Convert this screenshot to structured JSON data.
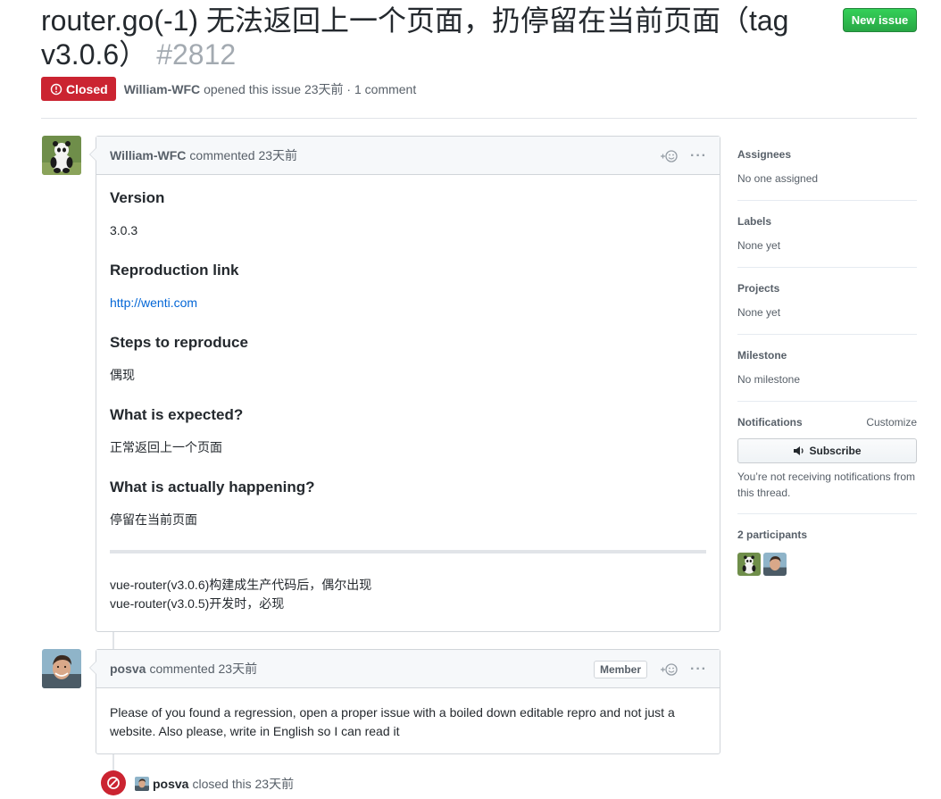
{
  "issue": {
    "title": "router.go(-1) 无法返回上一个页面，扔停留在当前页面（tag v3.0.6）",
    "number": "#2812",
    "state": "Closed",
    "author": "William-WFC",
    "meta": "opened this issue 23天前 · 1 comment"
  },
  "header": {
    "new_issue_label": "New issue"
  },
  "comments": [
    {
      "author": "William-WFC",
      "action": "commented 23天前",
      "reaction_label": "+☺",
      "more_label": "···",
      "body": {
        "h_version": "Version",
        "version": "3.0.3",
        "h_repro": "Reproduction link",
        "repro_link": "http://wenti.com",
        "h_steps": "Steps to reproduce",
        "steps": "偶现",
        "h_expected": "What is expected?",
        "expected": "正常返回上一个页面",
        "h_actual": "What is actually happening?",
        "actual": "停留在当前页面",
        "note_line1": "vue-router(v3.0.6)构建成生产代码后，偶尔出现",
        "note_line2": "vue-router(v3.0.5)开发时，必现"
      }
    },
    {
      "author": "posva",
      "action": "commented 23天前",
      "role": "Member",
      "reaction_label": "+☺",
      "more_label": "···",
      "body": "Please of you found a regression, open a proper issue with a boiled down editable repro and not just a website. Also please, write in English so I can read it"
    }
  ],
  "event": {
    "author": "posva",
    "text": "closed this 23天前"
  },
  "sidebar": {
    "assignees": {
      "heading": "Assignees",
      "value": "No one assigned"
    },
    "labels": {
      "heading": "Labels",
      "value": "None yet"
    },
    "projects": {
      "heading": "Projects",
      "value": "None yet"
    },
    "milestone": {
      "heading": "Milestone",
      "value": "No milestone"
    },
    "notifications": {
      "heading": "Notifications",
      "customize": "Customize",
      "subscribe": "Subscribe",
      "note": "You’re not receiving notifications from this thread."
    },
    "participants": {
      "heading": "2 participants"
    }
  },
  "colors": {
    "closed": "#cb2431",
    "new_issue": "#28a745",
    "link": "#0366d6"
  },
  "icons": [
    "issue-closed-icon",
    "smiley-icon",
    "kebab-icon",
    "speaker-icon",
    "circle-slash-icon"
  ]
}
